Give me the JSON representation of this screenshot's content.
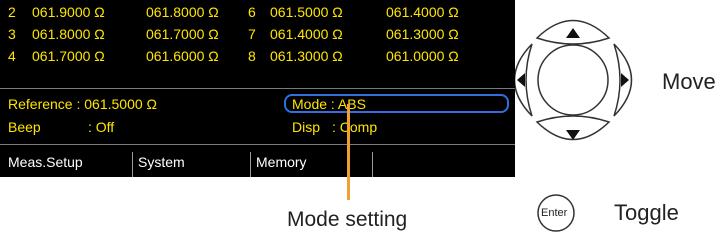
{
  "readings": [
    {
      "a_num": "2",
      "a_val1": "061.9000 Ω",
      "a_val2": "061.8000 Ω",
      "b_num": "6",
      "b_val1": "061.5000 Ω",
      "b_val2": "061.4000 Ω"
    },
    {
      "a_num": "3",
      "a_val1": "061.8000 Ω",
      "a_val2": "061.7000 Ω",
      "b_num": "7",
      "b_val1": "061.4000 Ω",
      "b_val2": "061.3000 Ω"
    },
    {
      "a_num": "4",
      "a_val1": "061.7000 Ω",
      "a_val2": "061.6000 Ω",
      "b_num": "8",
      "b_val1": "061.3000 Ω",
      "b_val2": "061.0000 Ω"
    }
  ],
  "info": {
    "reference": "Reference : 061.5000 Ω",
    "mode": "Mode : ABS",
    "beep_label": "Beep",
    "beep_value": ": Off",
    "disp_label": "Disp",
    "disp_value": ": Comp"
  },
  "menu": {
    "items": [
      "Meas.Setup",
      "System",
      "Memory"
    ]
  },
  "callout": {
    "label": "Mode setting"
  },
  "controls": {
    "move_label": "Move",
    "enter_key": "Enter",
    "toggle_label": "Toggle"
  },
  "colors": {
    "screen_bg": "#000000",
    "screen_text": "#ffe600",
    "mode_highlight": "#2f6fe0",
    "callout_line": "#f0a030"
  }
}
